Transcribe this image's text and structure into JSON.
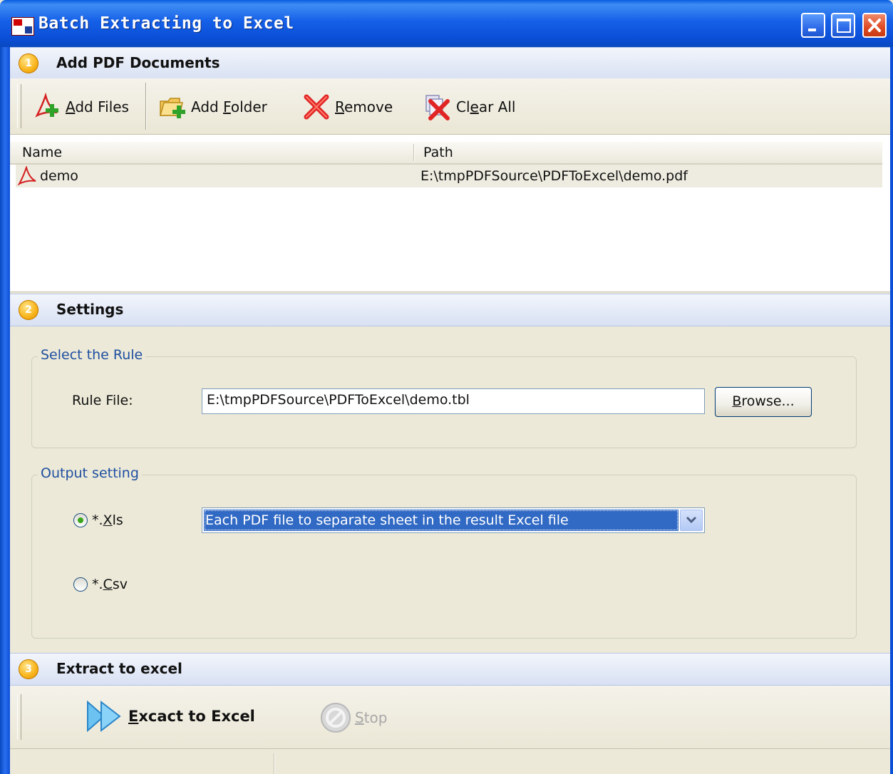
{
  "window": {
    "title": "Batch Extracting to Excel"
  },
  "sections": {
    "add": {
      "number": "1",
      "title": "Add PDF Documents"
    },
    "settings": {
      "number": "2",
      "title": "Settings"
    },
    "extract": {
      "number": "3",
      "title": "Extract to excel"
    }
  },
  "toolbar": {
    "add_files": {
      "mnemonic": "A",
      "rest": "dd Files"
    },
    "add_folder": {
      "pre": "Add ",
      "mnemonic": "F",
      "rest": "older"
    },
    "remove": {
      "mnemonic": "R",
      "rest": "emove"
    },
    "clear_all": {
      "pre": "Cl",
      "mnemonic": "e",
      "rest": "ar All"
    }
  },
  "file_list": {
    "columns": [
      "Name",
      "Path"
    ],
    "rows": [
      {
        "name": "demo",
        "path": "E:\\tmpPDFSource\\PDFToExcel\\demo.pdf"
      }
    ]
  },
  "rule_group": {
    "legend": "Select the Rule",
    "label": "Rule File:",
    "value": "E:\\tmpPDFSource\\PDFToExcel\\demo.tbl",
    "browse": {
      "mnemonic": "B",
      "rest": "rowse..."
    }
  },
  "output_group": {
    "legend": "Output setting",
    "xls": {
      "pre": "*.",
      "mnemonic": "X",
      "rest": "ls",
      "checked": true
    },
    "csv": {
      "pre": "*.",
      "mnemonic": "C",
      "rest": "sv",
      "checked": false
    },
    "mode_selected": "Each PDF file to separate sheet in the result Excel file"
  },
  "actions": {
    "extract": {
      "mnemonic": "E",
      "rest": "xcact to Excel"
    },
    "stop": {
      "mnemonic": "S",
      "rest": "top"
    }
  },
  "colors": {
    "titlebar": "#0b4fd8",
    "selection": "#316ac5",
    "group_legend": "#1f4fa0",
    "disabled_text": "#a8a8a8"
  }
}
